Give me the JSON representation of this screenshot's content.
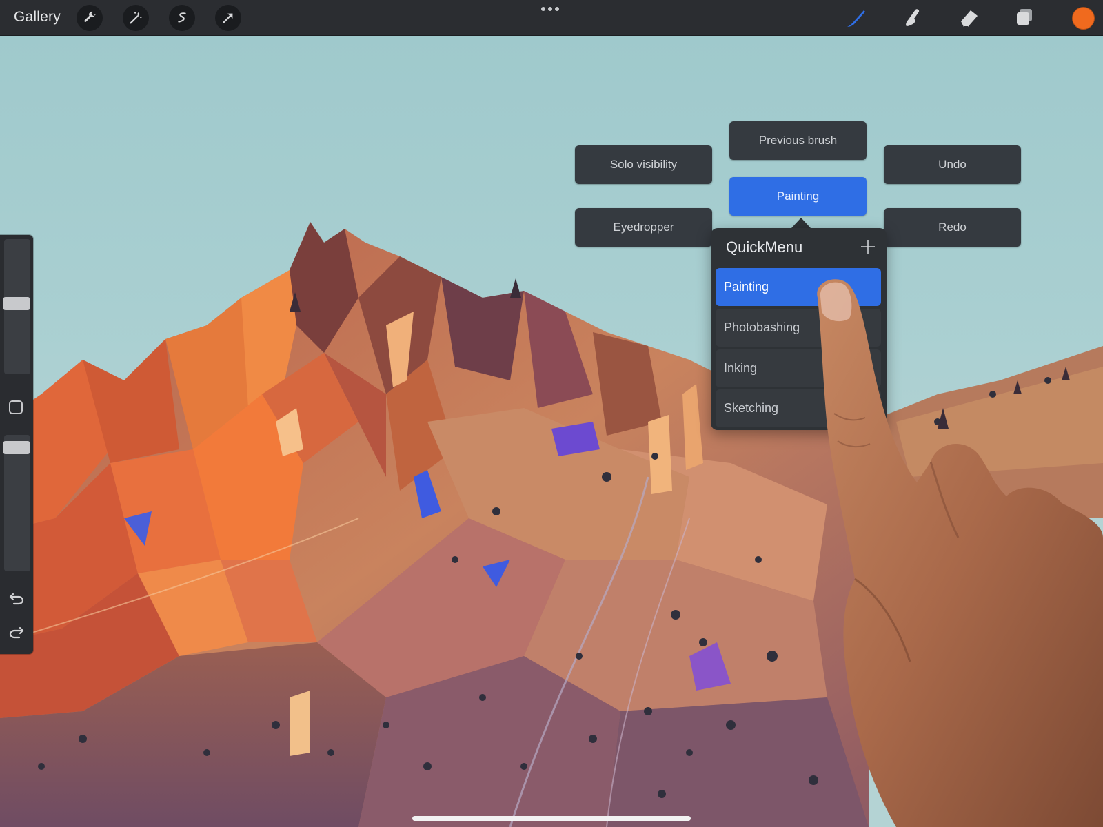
{
  "toolbar": {
    "gallery_label": "Gallery",
    "left_tools": [
      "wrench-icon",
      "magic-wand-icon",
      "selection-icon",
      "transform-arrow-icon"
    ],
    "right_tools": [
      "brush-icon",
      "smudge-icon",
      "eraser-icon",
      "layers-icon"
    ],
    "current_color": "#f06a1e"
  },
  "sidebar": {
    "brush_size_level": 0.53,
    "opacity_level": 0.95
  },
  "quickmenu": {
    "buttons": {
      "previous_brush": "Previous brush",
      "solo_visibility": "Solo visibility",
      "undo": "Undo",
      "painting": "Painting",
      "eyedropper": "Eyedropper",
      "redo": "Redo"
    },
    "panel": {
      "title": "QuickMenu",
      "items": [
        "Painting",
        "Photobashing",
        "Inking",
        "Sketching"
      ],
      "selected": "Painting"
    }
  },
  "colors": {
    "accent": "#2f6ee5",
    "toolbar_bg": "#2b2d31",
    "menu_button_bg": "#353a40"
  }
}
